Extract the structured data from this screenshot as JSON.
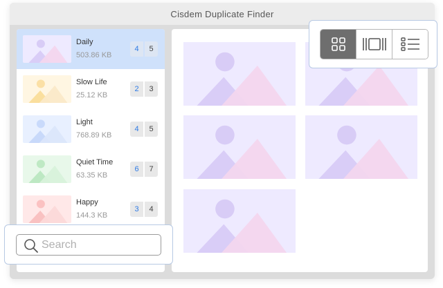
{
  "window": {
    "title": "Cisdem Duplicate Finder"
  },
  "groups": [
    {
      "name": "Daily",
      "size": "503.86 KB",
      "duplicates": "4",
      "total": "5",
      "theme": "lavender",
      "selected": true
    },
    {
      "name": "Slow Life",
      "size": "25.12 KB",
      "duplicates": "2",
      "total": "3",
      "theme": "yellow",
      "selected": false
    },
    {
      "name": "Light",
      "size": "768.89 KB",
      "duplicates": "4",
      "total": "5",
      "theme": "blue",
      "selected": false
    },
    {
      "name": "Quiet Time",
      "size": "63.35 KB",
      "duplicates": "6",
      "total": "7",
      "theme": "green",
      "selected": false
    },
    {
      "name": "Happy",
      "size": "144.3 KB",
      "duplicates": "3",
      "total": "4",
      "theme": "red",
      "selected": false
    }
  ],
  "view_modes": [
    {
      "icon": "grid-view-icon",
      "active": true
    },
    {
      "icon": "carousel-view-icon",
      "active": false
    },
    {
      "icon": "list-view-icon",
      "active": false
    }
  ],
  "search": {
    "placeholder": "Search",
    "value": ""
  },
  "thumb_themes": {
    "lavender": {
      "bg": "#eeeaff",
      "sun": "#d8ccf6",
      "mountain": "#d9cdf7",
      "accent": "#f3d6ee"
    },
    "yellow": {
      "bg": "#fff6e2",
      "sun": "#fbe0a6",
      "mountain": "#fadf9e",
      "accent": "#fbe9c8"
    },
    "blue": {
      "bg": "#e8f0ff",
      "sun": "#c9dafb",
      "mountain": "#c8d9fa",
      "accent": "#dbe6fb"
    },
    "green": {
      "bg": "#e8f8ea",
      "sun": "#bfe9c4",
      "mountain": "#bde8c3",
      "accent": "#d8f2db"
    },
    "red": {
      "bg": "#ffe8e8",
      "sun": "#fbc2c2",
      "mountain": "#f9c1c1",
      "accent": "#fcd9d9"
    }
  },
  "content_tiles": 5
}
